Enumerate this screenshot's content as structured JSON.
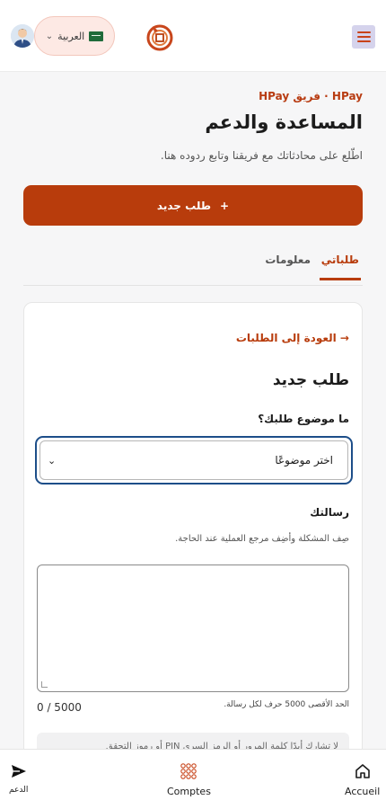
{
  "header": {
    "language": "العربية",
    "language_flag": "saudi-flag-icon",
    "logo": "hpay-logo",
    "menu_icon": "hamburger-menu-icon"
  },
  "page": {
    "breadcrumb": "HPay · فريق HPay",
    "title": "المساعدة والدعم",
    "subtitle": "اطّلع على محادثاتك مع فريقنا وتابع ردوده هنا.",
    "new_request_label": "طلب جديد",
    "new_request_icon": "+"
  },
  "tabs": [
    {
      "label": "طلباتي",
      "active": true
    },
    {
      "label": "معلومات",
      "active": false
    }
  ],
  "form": {
    "back_label": "→ العودة إلى الطلبات",
    "title": "طلب جديد",
    "topic_label": "ما موضوع طلبك؟",
    "topic_selected": "اختر موضوعًا",
    "message_label": "رسالتك",
    "message_help": "صِف المشكلة وأضِف مرجع العملية عند الحاجة.",
    "message_value": "",
    "counter": "0 / 5000",
    "limit_note": "الحد الأقصى 5000 حرف لكل رسالة.",
    "notice_text": "لا تشارك أبدًا كلمة المرور أو الرمز السري PIN أو رموز التحقق"
  },
  "bottom_nav": [
    {
      "label": "Accueil",
      "icon": "home-icon"
    },
    {
      "label": "Comptes",
      "icon": "grid-dots-icon"
    },
    {
      "label": "الدعم",
      "icon": "send-icon"
    }
  ],
  "colors": {
    "accent": "#b83c0c",
    "focus_ring": "#1d4e89",
    "lang_pill_bg": "#fde9e4",
    "menu_bg": "#d5d3ec"
  }
}
